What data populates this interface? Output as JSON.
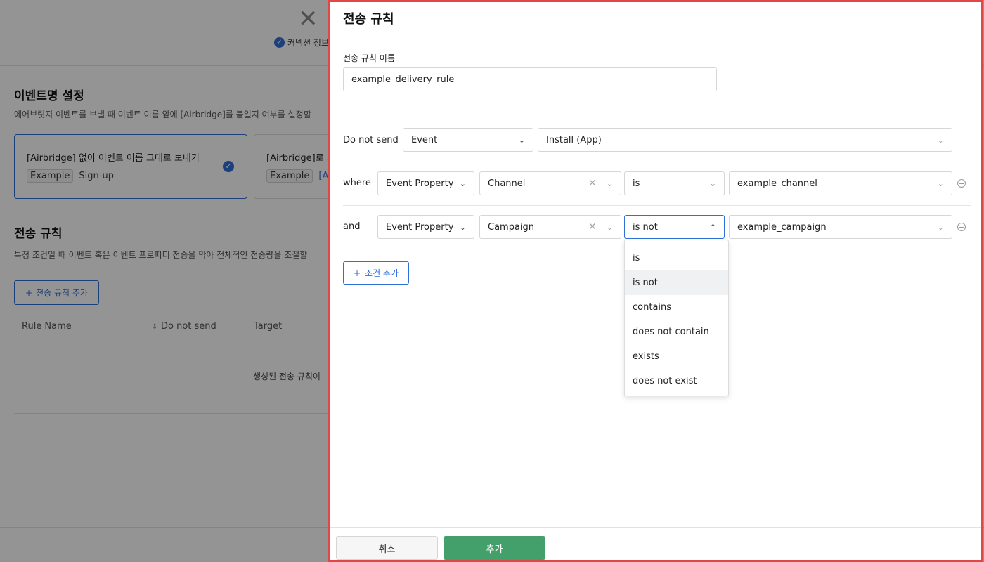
{
  "background": {
    "step_label": "커넥션 정보",
    "event_name_section": {
      "title": "이벤트명 설정",
      "description": "에어브릿지 이벤트를 보낼 때 이벤트 이름 앞에 [Airbridge]를 붙일지 여부를 설정할",
      "option_1": {
        "title": "[Airbridge] 없이 이벤트 이름 그대로 보내기",
        "tag": "Example",
        "example": "Sign-up"
      },
      "option_2": {
        "title": "[Airbridge]로 시",
        "tag": "Example",
        "example": "[Ai"
      }
    },
    "delivery_section": {
      "title": "전송 규칙",
      "description": "특정 조건일 때 이벤트 혹은 이벤트 프로퍼티 전송을 막아 전체적인 전송량을 조절할",
      "add_button": "전송 규칙 추가",
      "columns": [
        "Rule Name",
        "Do not send",
        "Target"
      ],
      "empty_text": "생성된 전송 규칙이"
    }
  },
  "drawer": {
    "title": "전송 규칙",
    "name_label": "전송 규칙 이름",
    "name_value": "example_delivery_rule",
    "do_not_send": {
      "label": "Do not send",
      "type": "Event",
      "value": "Install (App)"
    },
    "conditions": [
      {
        "label": "where",
        "property_type": "Event Property",
        "property": "Channel",
        "operator": "is",
        "value": "example_channel"
      },
      {
        "label": "and",
        "property_type": "Event Property",
        "property": "Campaign",
        "operator": "is not",
        "value": "example_campaign"
      }
    ],
    "operator_options": [
      "is",
      "is not",
      "contains",
      "does not contain",
      "exists",
      "does not exist"
    ],
    "selected_operator": "is not",
    "add_condition": "조건 추가",
    "cancel": "취소",
    "submit": "추가"
  },
  "colors": {
    "accent": "#2f6fd6",
    "submit": "#43a06a",
    "highlight_border": "#e04848"
  },
  "icons": [
    "close-icon",
    "check-circle-icon",
    "plus-icon",
    "chevron-down-icon",
    "chevron-up-icon",
    "clear-icon",
    "remove-circle-icon",
    "sort-icon"
  ]
}
